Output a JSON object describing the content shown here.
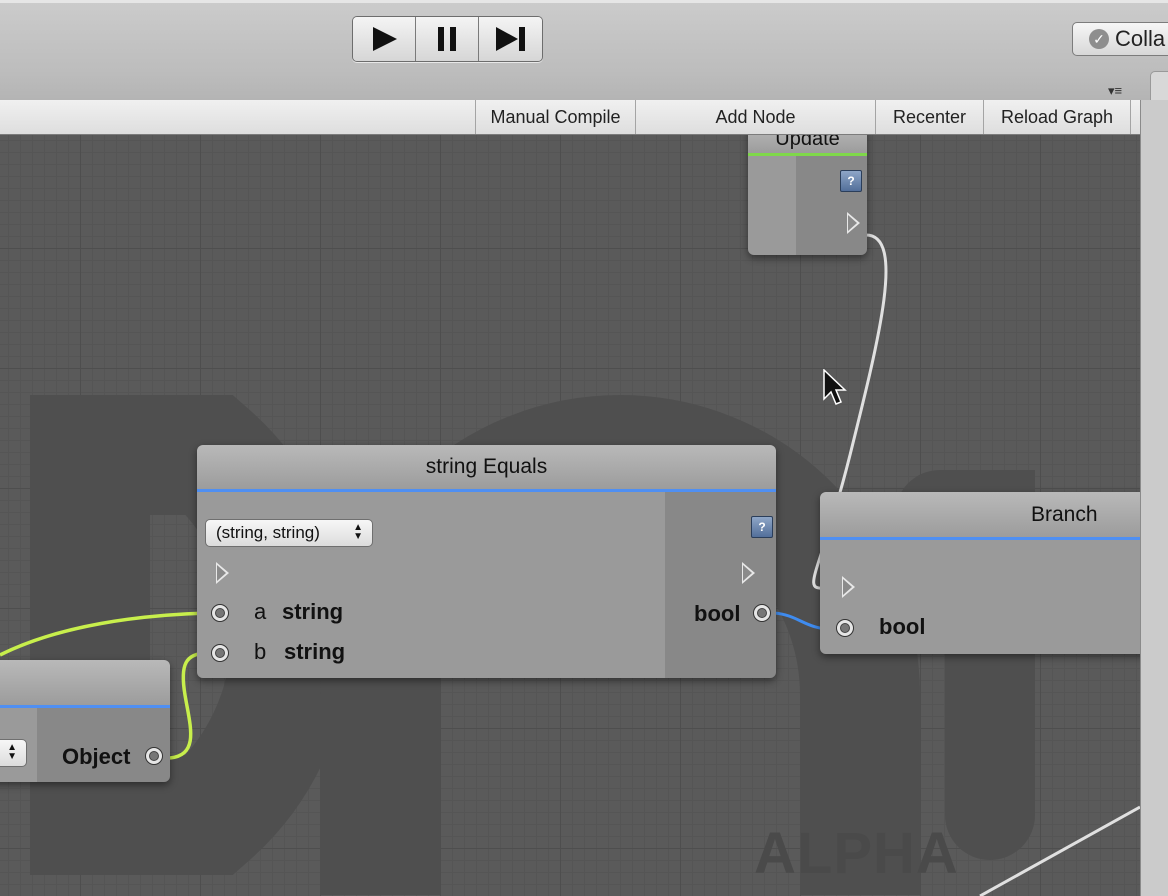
{
  "toolbar": {
    "play_icon": "play-icon",
    "pause_icon": "pause-icon",
    "step_icon": "step-icon",
    "collab_label": "Colla"
  },
  "graph_toolbar": {
    "manual_compile": "Manual Compile",
    "add_node": "Add Node",
    "recenter": "Recenter",
    "reload_graph": "Reload Graph"
  },
  "watermark": {
    "text": "ALPHA"
  },
  "nodes": {
    "update": {
      "title": "Update",
      "header_color": "#7fd84a"
    },
    "string_equals": {
      "title": "string Equals",
      "header_color": "#4f8ff2",
      "overload_selected": "(string, string)",
      "inputs": [
        {
          "name": "a",
          "type": "string"
        },
        {
          "name": "b",
          "type": "string"
        }
      ],
      "output_type": "bool"
    },
    "branch": {
      "title": "Branch",
      "header_color": "#4f8ff2",
      "input_type": "bool"
    },
    "object_node": {
      "output_type": "Object",
      "header_color": "#4f8ff2"
    }
  },
  "colors": {
    "string_wire": "#c8ef4c",
    "bool_wire": "#3f8cf0",
    "exec_wire": "#e0e0e0"
  }
}
